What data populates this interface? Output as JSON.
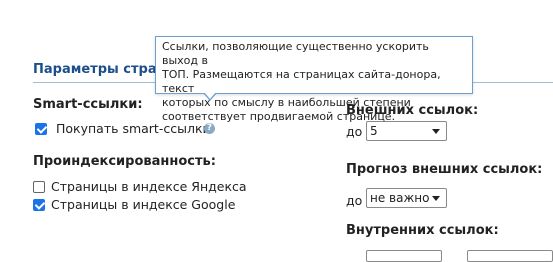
{
  "section": {
    "title": "Параметры стра"
  },
  "smart_links": {
    "heading": "Smart-ссылки:",
    "buy_label": "Покупать smart-ссылки",
    "buy_checked": true,
    "help_icon": "question-circle-icon",
    "help_glyph": "?"
  },
  "indexing": {
    "heading": "Проиндексированность:",
    "options": [
      {
        "label": "Страницы в индексе Яндекса",
        "checked": false
      },
      {
        "label": "Страницы в индексе Google",
        "checked": true
      }
    ]
  },
  "right": {
    "external_links_heading": "Внешних ссылок:",
    "external_links_prefix": "до",
    "external_links_value": "5",
    "forecast_heading": "Прогноз внешних ссылок:",
    "forecast_prefix": "до",
    "forecast_value": "не важно",
    "internal_links_heading": "Внутренних ссылок:"
  },
  "tooltip": {
    "lines": [
      "Ссылки, позволяющие существенно ускорить выход в",
      "ТОП. Размещаются на страницах сайта-донора, текст",
      "которых по смыслу в наибольшей степени",
      "соответствует продвигаемой странице."
    ]
  },
  "colors": {
    "accent": "#1a73e8",
    "section_title": "#1c4f8a",
    "tooltip_border": "#6d9fcf"
  }
}
